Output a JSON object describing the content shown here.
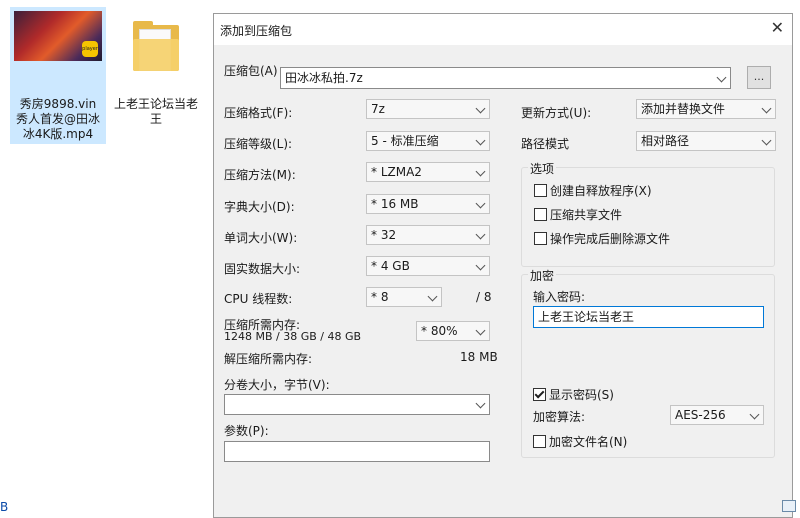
{
  "desktop": {
    "video_file": {
      "label": "秀房9898.vin秀人首发@田冰冰4K版.mp4",
      "badge": "player"
    },
    "folder": {
      "label": "上老王论坛当老王"
    },
    "bottom_edge_text": "B"
  },
  "dialog": {
    "title": "添加到压缩包",
    "archive": {
      "label": "压缩包(A)",
      "value": "田冰冰私拍.7z",
      "browse_label": "..."
    },
    "left": {
      "format": {
        "label": "压缩格式(F):",
        "value": "7z"
      },
      "level": {
        "label": "压缩等级(L):",
        "value": "5 - 标准压缩"
      },
      "method": {
        "label": "压缩方法(M):",
        "value": "* LZMA2"
      },
      "dict": {
        "label": "字典大小(D):",
        "value": "* 16 MB"
      },
      "word": {
        "label": "单词大小(W):",
        "value": "* 32"
      },
      "solid": {
        "label": "固实数据大小:",
        "value": "* 4 GB"
      },
      "threads": {
        "label": "CPU 线程数:",
        "value": "* 8",
        "max": "/ 8"
      },
      "mem_compress": {
        "label": "压缩所需内存:",
        "detail": "1248 MB / 38 GB / 48 GB",
        "value": "* 80%"
      },
      "mem_decompress": {
        "label": "解压缩所需内存:",
        "value": "18 MB"
      },
      "volume": {
        "label": "分卷大小，字节(V):",
        "value": ""
      },
      "params": {
        "label": "参数(P):",
        "value": ""
      }
    },
    "right": {
      "update": {
        "label": "更新方式(U):",
        "value": "添加并替换文件"
      },
      "path": {
        "label": "路径模式",
        "value": "相对路径"
      },
      "options": {
        "title": "选项",
        "sfx": {
          "label": "创建自释放程序(X)",
          "checked": false
        },
        "shared": {
          "label": "压缩共享文件",
          "checked": false
        },
        "delete": {
          "label": "操作完成后删除源文件",
          "checked": false
        }
      },
      "encryption": {
        "title": "加密",
        "password_label": "输入密码:",
        "password_value": "上老王论坛当老王",
        "show_password": {
          "label": "显示密码(S)",
          "checked": true
        },
        "method_label": "加密算法:",
        "method_value": "AES-256",
        "encrypt_names": {
          "label": "加密文件名(N)",
          "checked": false
        }
      }
    }
  }
}
